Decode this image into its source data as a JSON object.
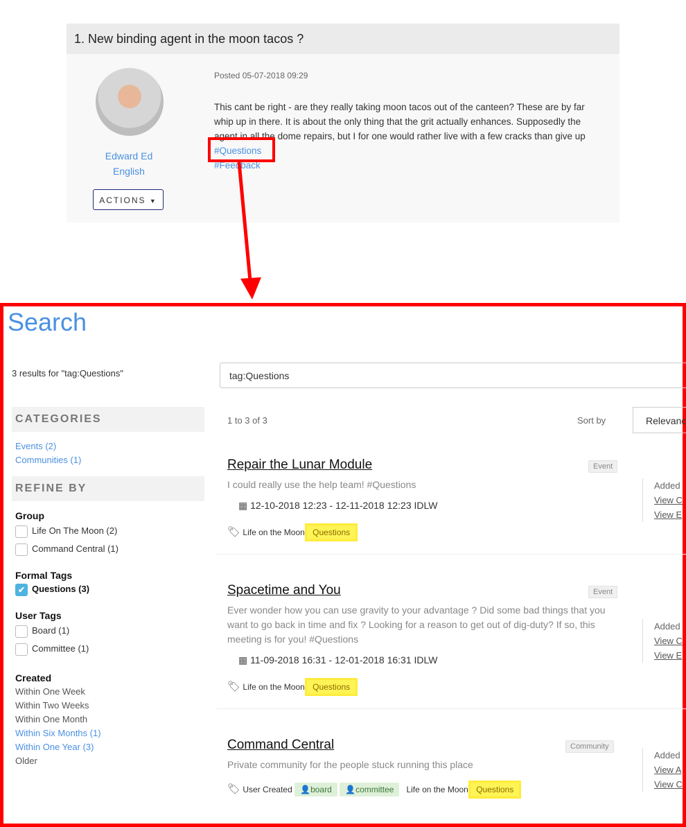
{
  "post": {
    "title": "1.  New binding agent in the moon tacos ?",
    "posted": "Posted 05-07-2018 09:29",
    "author_first": "Edward Ed",
    "author_last": "English",
    "actions_label": "ACTIONS",
    "body_lines": [
      "This cant be right - are they really taking moon tacos out of the canteen? These are by far",
      "whip up in there.  It is about the only thing that the grit actually enhances.  Supposedly the",
      "agent in all the dome repairs, but I for one would rather live with a few cracks than give up"
    ],
    "tags": [
      "#Questions",
      "#Feedback"
    ]
  },
  "search": {
    "title": "Search",
    "results_summary": "3 results for \"tag:Questions\"",
    "query": "tag:Questions",
    "range": "1 to 3 of 3",
    "sort_label": "Sort by",
    "sort_value": "Relevance"
  },
  "sidebar": {
    "categories_title": "CATEGORIES",
    "categories": [
      "Events (2)",
      "Communities (1)"
    ],
    "refine_title": "REFINE BY",
    "group_title": "Group",
    "groups": [
      "Life On The Moon (2)",
      "Command Central (1)"
    ],
    "formal_title": "Formal Tags",
    "formal": [
      "Questions (3)"
    ],
    "user_title": "User Tags",
    "user": [
      "Board (1)",
      "Committee (1)"
    ],
    "created_title": "Created",
    "created": [
      "Within One Week",
      "Within Two Weeks",
      "Within One Month",
      "Within Six Months (1)",
      "Within One Year (3)",
      "Older"
    ]
  },
  "results": [
    {
      "title": "Repair the Lunar Module",
      "type": "Event",
      "desc": "I could really use the help team! #Questions",
      "dates": "12-10-2018 12:23 - 12-11-2018 12:23 IDLW",
      "group": "Life on the Moon",
      "tag": "Questions",
      "side": [
        "Added",
        "View C",
        "View E"
      ]
    },
    {
      "title": "Spacetime and You",
      "type": "Event",
      "desc": "Ever wonder how you can use gravity to your advantage ? Did some bad things that you want to go back in time and fix ? Looking for a reason to get out of dig-duty? If so, this meeting is for you! #Questions",
      "dates": "11-09-2018 16:31 - 12-01-2018 16:31 IDLW",
      "group": "Life on the Moon",
      "tag": "Questions",
      "side": [
        "Added",
        "View C",
        "View E"
      ]
    },
    {
      "title": "Command Central",
      "type": "Community",
      "desc": "Private community for the people stuck running this place",
      "user_created": "User Created",
      "user_tags": [
        "board",
        "committee"
      ],
      "group": "Life on the Moon",
      "tag": "Questions",
      "side": [
        "Added",
        "View A",
        "View C"
      ]
    }
  ],
  "colors": {
    "accent": "#4a90e2",
    "highlight": "#f00",
    "tag_highlight": "#fff455"
  }
}
